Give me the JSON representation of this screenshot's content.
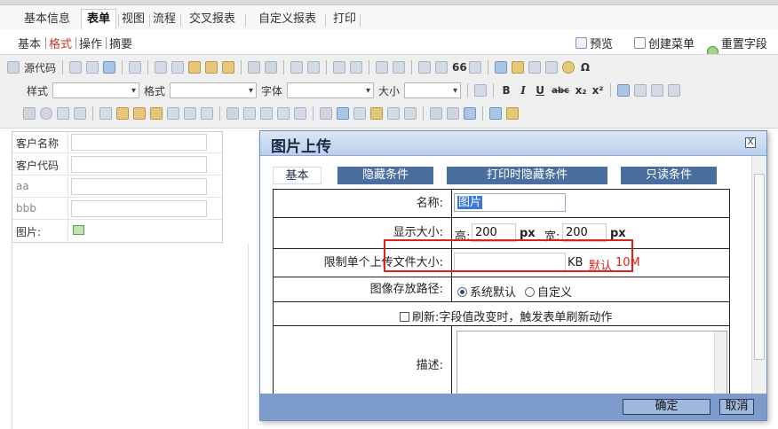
{
  "tabs": [
    {
      "label": "基本信息"
    },
    {
      "label": "表单"
    },
    {
      "label": "视图"
    },
    {
      "label": "流程"
    },
    {
      "label": "交叉报表"
    },
    {
      "label": "自定义报表"
    },
    {
      "label": "打印"
    }
  ],
  "subtabs": [
    {
      "label": "基本"
    },
    {
      "label": "格式"
    },
    {
      "label": "操作"
    },
    {
      "label": "摘要"
    }
  ],
  "actions": {
    "preview": "预览",
    "create_menu": "创建菜单",
    "reset_fields": "重置字段编"
  },
  "toolbar": {
    "source_code": "源代码",
    "style_label": "样式",
    "format_label": "格式",
    "font_label": "字体",
    "size_label": "大小",
    "bold": "B",
    "italic": "I",
    "underline": "U",
    "strike": "abc",
    "subscript": "x₂",
    "superscript": "x²",
    "omega": "Ω",
    "quote": "66"
  },
  "left_form": {
    "rows": [
      {
        "label": "客户名称"
      },
      {
        "label": "客户代码"
      },
      {
        "label": "aa"
      },
      {
        "label": "bbb"
      },
      {
        "label": "图片:"
      }
    ]
  },
  "dialog": {
    "title": "图片上传",
    "close_glyph": "X",
    "tabs": [
      {
        "label": "基本"
      },
      {
        "label": "隐藏条件"
      },
      {
        "label": "打印时隐藏条件"
      },
      {
        "label": "只读条件"
      }
    ],
    "name_label": "名称:",
    "name_value": "图片",
    "display_size_label": "显示大小:",
    "height_label": "高:",
    "height_value": "200",
    "width_label": "宽:",
    "width_value": "200",
    "unit": "px",
    "max_size_label": "限制单个上传文件大小:",
    "max_size_value": "",
    "max_size_unit": "KB",
    "default_text": "默认",
    "default_value": "10M",
    "path_label": "图像存放路径:",
    "path_options": [
      {
        "label": "系统默认",
        "selected": true
      },
      {
        "label": "自定义",
        "selected": false
      }
    ],
    "refresh_label": "刷新:",
    "refresh_text": "字段值改变时，触发表单刷新动作",
    "description_label": "描述:",
    "ok_button": "确定",
    "cancel_button": "取消"
  },
  "colors": {
    "dialog_title_bg": "#bcd0ec",
    "tab_bg": "#4a6f9e",
    "footer_bg": "#7d9ccc",
    "highlight_border": "#d9241c",
    "default_text": "#d9241c"
  }
}
